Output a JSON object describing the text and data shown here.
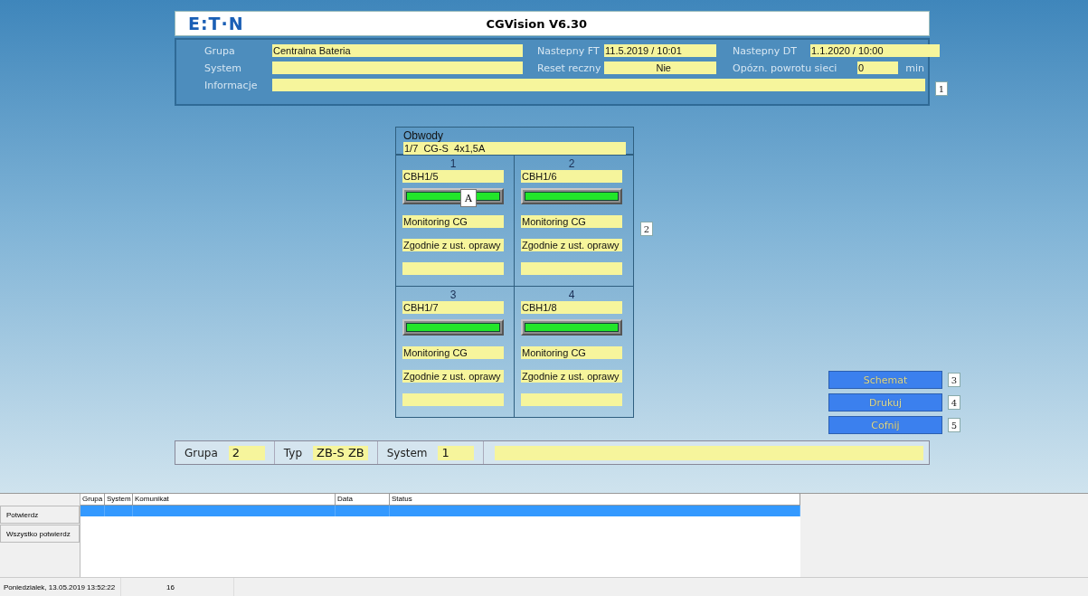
{
  "header": {
    "logo": "E:T·N",
    "title": "CGVision V6.30"
  },
  "info": {
    "marker": "1",
    "rows": [
      [
        {
          "label": "Grupa",
          "value": "Centralna Bateria"
        },
        {
          "label": "Nastepny FT",
          "value": "11.5.2019 / 10:01"
        },
        {
          "label": "Nastepny DT",
          "value": "1.1.2020 / 10:00"
        }
      ],
      [
        {
          "label": "System"
        },
        {
          "label": "Reset reczny",
          "value": "Nie"
        },
        {
          "label": "Opózn. powrotu sieci",
          "value": "0",
          "unit": "min"
        }
      ],
      [
        {
          "label": "Informacje"
        }
      ]
    ]
  },
  "circuits": {
    "title": "Obwody",
    "subtitle": "1/7  CG-S  4x1,5A",
    "marker": "2",
    "cells": [
      {
        "number": "1",
        "name": "CBH1/5",
        "badge": "A",
        "mode": "Monitoring CG",
        "setting": "Zgodnie z ust. oprawy"
      },
      {
        "number": "2",
        "name": "CBH1/6",
        "mode": "Monitoring CG",
        "setting": "Zgodnie z ust. oprawy"
      },
      {
        "number": "3",
        "name": "CBH1/7",
        "mode": "Monitoring CG",
        "setting": "Zgodnie z ust. oprawy"
      },
      {
        "number": "4",
        "name": "CBH1/8",
        "mode": "Monitoring CG",
        "setting": "Zgodnie z ust. oprawy"
      }
    ]
  },
  "actions": [
    {
      "label": "Schemat",
      "marker": "3"
    },
    {
      "label": "Drukuj",
      "marker": "4"
    },
    {
      "label": "Cofnij",
      "marker": "5"
    }
  ],
  "summary_bar": [
    {
      "label": "Grupa",
      "value": "2"
    },
    {
      "label": "Typ",
      "value": "ZB-S ZB"
    },
    {
      "label": "System",
      "value": "1"
    }
  ],
  "alarms": {
    "buttons": [
      "Potwierdz",
      "Wszystko potwierdz"
    ],
    "columns": [
      "Grupa",
      "System",
      "Komunikat",
      "Data",
      "Status"
    ],
    "rows": [
      {
        "selected": true
      }
    ]
  },
  "status_bar": [
    "Poniedzialek, 13.05.2019 13:52:22",
    "16"
  ]
}
